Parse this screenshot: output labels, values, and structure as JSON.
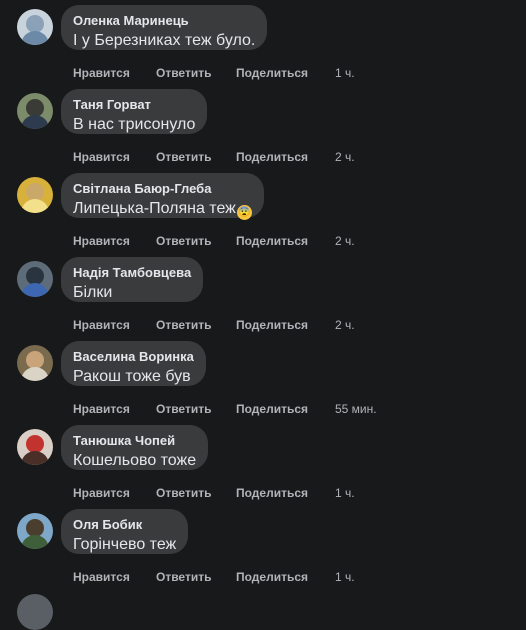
{
  "actions": {
    "like": "Нравится",
    "reply": "Ответить",
    "share": "Поделиться"
  },
  "comments": [
    {
      "author": "Оленка Маринець",
      "text": "І у Березниках теж було.",
      "emoji": "",
      "time": "1 ч.",
      "avatar_colors": [
        "#c9d3dc",
        "#8aa1b8",
        "#6c8aa8"
      ]
    },
    {
      "author": "Таня Горват",
      "text": "В нас трисонуло",
      "emoji": "",
      "time": "2 ч.",
      "avatar_colors": [
        "#7c8b6a",
        "#3a3a36",
        "#2e3b4e"
      ]
    },
    {
      "author": "Світлана Баюр-Глеба",
      "text": "Липецька-Поляна теж",
      "emoji": "😨",
      "time": "2 ч.",
      "avatar_colors": [
        "#d7b13a",
        "#caa86a",
        "#f2e08a"
      ]
    },
    {
      "author": "Надія Тамбовцева",
      "text": "Білки",
      "emoji": "",
      "time": "2 ч.",
      "avatar_colors": [
        "#5e6c7a",
        "#2a3340",
        "#3d67b0"
      ]
    },
    {
      "author": "Васелина Воринка",
      "text": "Ракош тоже був",
      "emoji": "",
      "time": "55 мин.",
      "avatar_colors": [
        "#7a6a4e",
        "#c9a37a",
        "#d9d4c6"
      ]
    },
    {
      "author": "Танюшка Чопей",
      "text": "Кошельово тоже",
      "emoji": "",
      "time": "1 ч.",
      "avatar_colors": [
        "#d9cfc6",
        "#c2322e",
        "#4a2f28"
      ]
    },
    {
      "author": "Оля Бобик",
      "text": "Горінчево теж",
      "emoji": "",
      "time": "1 ч.",
      "avatar_colors": [
        "#7fa8c8",
        "#4a3e2e",
        "#3f5f3a"
      ]
    }
  ]
}
